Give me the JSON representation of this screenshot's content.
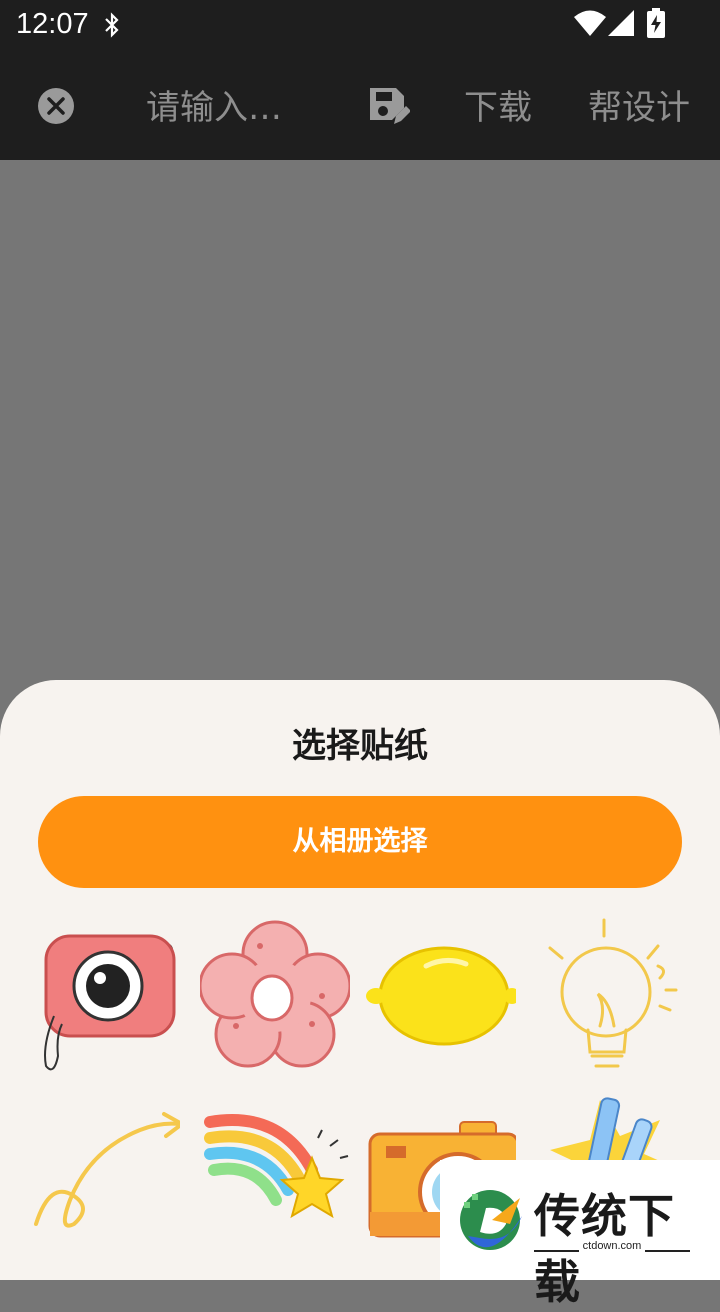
{
  "status_bar": {
    "time": "12:07",
    "icons": [
      "bluetooth-icon",
      "wifi-icon",
      "signal-icon",
      "battery-charging-icon"
    ]
  },
  "toolbar": {
    "close_icon": "close-circle-icon",
    "title_placeholder": "请输入…",
    "save_icon": "save-edit-icon",
    "download_label": "下载",
    "design_label": "帮设计"
  },
  "sheet": {
    "title": "选择贴纸",
    "album_button": "从相册选择",
    "accent_color": "#ff9110",
    "stickers": [
      {
        "icon": "pink-camera-sticker"
      },
      {
        "icon": "pink-flower-sticker"
      },
      {
        "icon": "lemon-sticker"
      },
      {
        "icon": "lightbulb-sticker"
      },
      {
        "icon": "curly-arrow-sticker"
      },
      {
        "icon": "rainbow-star-sticker"
      },
      {
        "icon": "orange-camera-sticker"
      },
      {
        "icon": "crystal-burst-sticker"
      }
    ]
  },
  "watermark": {
    "brand": "传统下载",
    "domain": "ctdown.com"
  }
}
